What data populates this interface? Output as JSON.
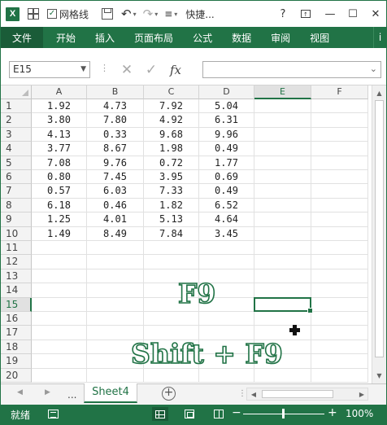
{
  "titlebar": {
    "app_logo": "X",
    "gridlines_checkbox": "✓",
    "gridlines_label": "网格线",
    "quick_access_label": "快捷...",
    "help": "?",
    "restore_ribbon": "🗖",
    "minimize": "—",
    "maximize": "☐",
    "close": "✕"
  },
  "ribbon": {
    "tabs": [
      "文件",
      "开始",
      "插入",
      "页面布局",
      "公式",
      "数据",
      "审阅",
      "视图"
    ],
    "more": "i"
  },
  "formula_bar": {
    "name_box": "E15",
    "cancel_glyph": "✕",
    "enter_glyph": "✓",
    "fx_glyph": "fx",
    "formula_value": ""
  },
  "sheet": {
    "columns": [
      "A",
      "B",
      "C",
      "D",
      "E",
      "F"
    ],
    "rows": [
      "1",
      "2",
      "3",
      "4",
      "5",
      "6",
      "7",
      "8",
      "9",
      "10",
      "11",
      "12",
      "13",
      "14",
      "15",
      "16",
      "17",
      "18",
      "19",
      "20"
    ],
    "data": [
      [
        "1.92",
        "4.73",
        "7.92",
        "5.04"
      ],
      [
        "3.80",
        "7.80",
        "4.92",
        "6.31"
      ],
      [
        "4.13",
        "0.33",
        "9.68",
        "9.96"
      ],
      [
        "3.77",
        "8.67",
        "1.98",
        "0.49"
      ],
      [
        "7.08",
        "9.76",
        "0.72",
        "1.77"
      ],
      [
        "0.80",
        "7.45",
        "3.95",
        "0.69"
      ],
      [
        "0.57",
        "6.03",
        "7.33",
        "0.49"
      ],
      [
        "6.18",
        "0.46",
        "1.82",
        "6.52"
      ],
      [
        "1.25",
        "4.01",
        "5.13",
        "4.64"
      ],
      [
        "1.49",
        "8.49",
        "7.84",
        "3.45"
      ]
    ],
    "selected_column": "E",
    "selected_row": "15"
  },
  "overlay": {
    "f9": "F9",
    "shift_f9": "Shift + F9"
  },
  "tabs_bar": {
    "prev": "◀",
    "next": "▶",
    "ellipsis": "...",
    "sheet_name": "Sheet4",
    "add_sheet": "+"
  },
  "statusbar": {
    "ready": "就绪",
    "zoom_minus": "−",
    "zoom_plus": "+",
    "zoom_level": "100%"
  },
  "colors": {
    "accent": "#217346"
  }
}
